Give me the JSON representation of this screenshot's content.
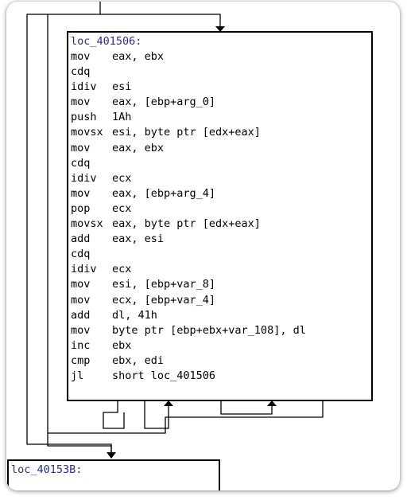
{
  "main_block": {
    "label": "loc_401506:",
    "instructions": [
      {
        "mnemonic": "mov",
        "operands": "eax, ebx"
      },
      {
        "mnemonic": "cdq",
        "operands": ""
      },
      {
        "mnemonic": "idiv",
        "operands": "esi"
      },
      {
        "mnemonic": "mov",
        "operands": "eax, [ebp+arg_0]"
      },
      {
        "mnemonic": "push",
        "operands": "1Ah"
      },
      {
        "mnemonic": "movsx",
        "operands": "esi, byte ptr [edx+eax]"
      },
      {
        "mnemonic": "mov",
        "operands": "eax, ebx"
      },
      {
        "mnemonic": "cdq",
        "operands": ""
      },
      {
        "mnemonic": "idiv",
        "operands": "ecx"
      },
      {
        "mnemonic": "mov",
        "operands": "eax, [ebp+arg_4]"
      },
      {
        "mnemonic": "pop",
        "operands": "ecx"
      },
      {
        "mnemonic": "movsx",
        "operands": "eax, byte ptr [edx+eax]"
      },
      {
        "mnemonic": "add",
        "operands": "eax, esi"
      },
      {
        "mnemonic": "cdq",
        "operands": ""
      },
      {
        "mnemonic": "idiv",
        "operands": "ecx"
      },
      {
        "mnemonic": "mov",
        "operands": "esi, [ebp+var_8]"
      },
      {
        "mnemonic": "mov",
        "operands": "ecx, [ebp+var_4]"
      },
      {
        "mnemonic": "add",
        "operands": "dl, 41h"
      },
      {
        "mnemonic": "mov",
        "operands": "byte ptr [ebp+ebx+var_108], dl"
      },
      {
        "mnemonic": "inc",
        "operands": "ebx"
      },
      {
        "mnemonic": "cmp",
        "operands": "ebx, edi"
      },
      {
        "mnemonic": "jl",
        "operands": "short loc_401506"
      }
    ]
  },
  "next_block": {
    "label": "loc_40153B:"
  },
  "colors": {
    "label": "#2a2a9a",
    "edge": "#000000",
    "text": "#000000"
  }
}
